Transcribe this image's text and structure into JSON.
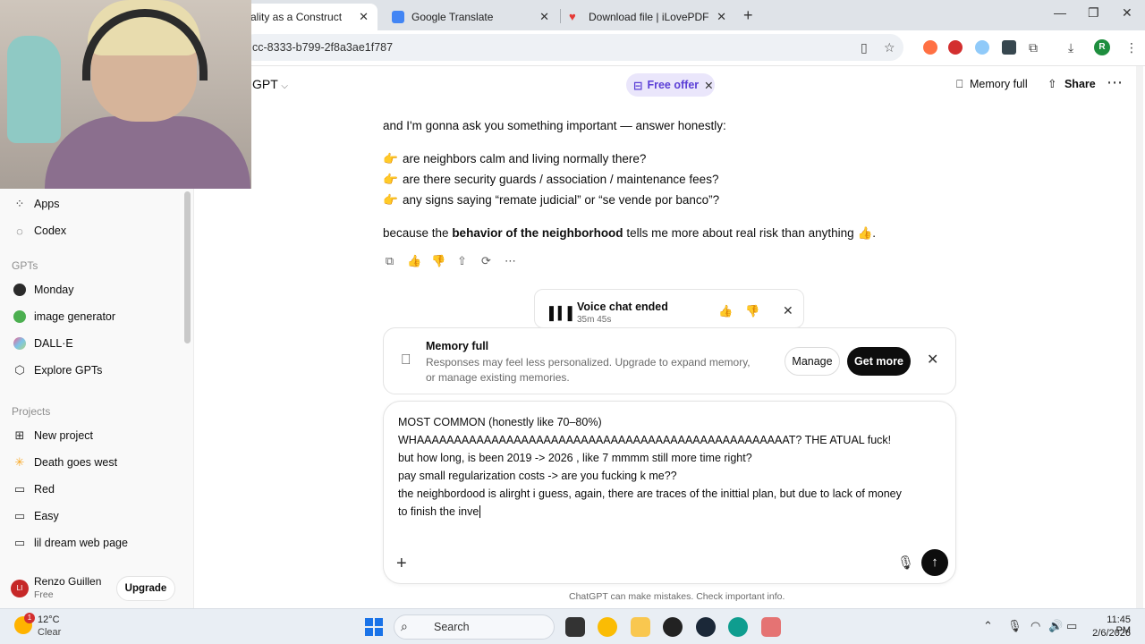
{
  "browser": {
    "tabs": [
      {
        "title": "ality as a Construct"
      },
      {
        "title": "Google Translate"
      },
      {
        "title": "Download file | iLovePDF"
      }
    ],
    "url": "cc-8333-b799-2f8a3ae1f787"
  },
  "header": {
    "model": "GPT",
    "free_offer": "Free offer",
    "memory_full": "Memory full",
    "share": "Share"
  },
  "sidebar": {
    "top_items": [
      {
        "label": "Apps",
        "icon": "apps-icon"
      },
      {
        "label": "Codex",
        "icon": "codex-icon"
      }
    ],
    "gpts_heading": "GPTs",
    "gpts": [
      {
        "label": "Monday",
        "icon": "monday-icon",
        "color": "#2b2b2b"
      },
      {
        "label": "image generator",
        "icon": "image-generator-icon",
        "color": "#4caf50"
      },
      {
        "label": "DALL·E",
        "icon": "dalle-icon",
        "color": "#7cc4e8"
      },
      {
        "label": "Explore GPTs",
        "icon": "explore-icon",
        "color": "#333333"
      }
    ],
    "projects_heading": "Projects",
    "projects": [
      {
        "label": "New project",
        "icon": "new-folder-icon"
      },
      {
        "label": "Death goes west",
        "icon": "sparkle-icon"
      },
      {
        "label": "Red",
        "icon": "folder-icon"
      },
      {
        "label": "Easy",
        "icon": "folder-icon"
      },
      {
        "label": "lil dream web page",
        "icon": "folder-icon"
      }
    ],
    "user": {
      "initials": "LI",
      "name": "Renzo Guillen",
      "plan": "Free",
      "upgrade": "Upgrade"
    }
  },
  "conversation": {
    "intro": "and I'm gonna ask you something important — answer honestly:",
    "bullets": [
      "are neighbors calm and living normally there?",
      "are there security guards / association / maintenance fees?",
      "any signs saying “remate judicial” or “se vende por banco”?"
    ],
    "closing_pre": "because the ",
    "closing_bold": "behavior of the neighborhood",
    "closing_post": " tells me more about real risk than anything 👍."
  },
  "voice_chat": {
    "title": "Voice chat ended",
    "duration": "35m 45s"
  },
  "memory_banner": {
    "title": "Memory full",
    "description": "Responses may feel less personalized. Upgrade to expand memory, or manage existing memories.",
    "manage": "Manage",
    "get_more": "Get more"
  },
  "composer": {
    "lines": [
      "MOST COMMON (honestly like 70–80%)",
      "WHAAAAAAAAAAAAAAAAAAAAAAAAAAAAAAAAAAAAAAAAAAAAAAAAAAT? THE ATUAL fuck!",
      "but how long, is been 2019 -> 2026 , like 7 mmmm still more time right?",
      "pay small regularization costs ->  are you fucking k me??",
      "the neighbordood is alirght i guess, again, there are traces of the inittial plan, but due to lack of money",
      "to finish the inve"
    ]
  },
  "disclaimer": "ChatGPT can make mistakes. Check important info.",
  "taskbar": {
    "weather_temp": "12°C",
    "weather_desc": "Clear",
    "weather_badge": "1",
    "search": "Search",
    "time": "11:45 PM",
    "date": "2/6/2026"
  }
}
